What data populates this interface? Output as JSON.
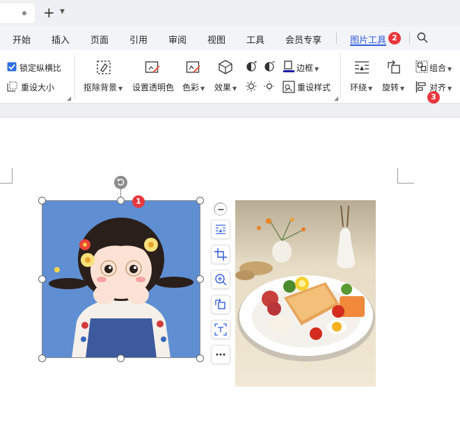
{
  "menu": {
    "items": [
      "开始",
      "插入",
      "页面",
      "引用",
      "审阅",
      "视图",
      "工具",
      "会员专享",
      "图片工具"
    ],
    "active": "图片工具"
  },
  "ribbon": {
    "lock_ratio_label": "锁定纵横比",
    "lock_ratio_checked": true,
    "reset_size_label": "重设大小",
    "remove_bg_label": "抠除背景",
    "set_transparent_label": "设置透明色",
    "color_label": "色彩",
    "effect_label": "效果",
    "border_label": "边框",
    "reset_style_label": "重设样式",
    "wrap_label": "环绕",
    "rotate_label": "旋转",
    "group_label": "组合",
    "align_label": "对齐"
  },
  "badges": {
    "image": "1",
    "picture_tools": "2",
    "align": "3"
  },
  "colors": {
    "accent": "#2f5ad8",
    "badge": "#e8383d",
    "checkbox": "#2f6fe0",
    "girl_bg": "#5f8fd2"
  },
  "float_toolbar": [
    "collapse-icon",
    "wrap-layout-icon",
    "crop-icon",
    "zoom-icon",
    "rotate-icon",
    "ocr-icon",
    "more-icon"
  ]
}
